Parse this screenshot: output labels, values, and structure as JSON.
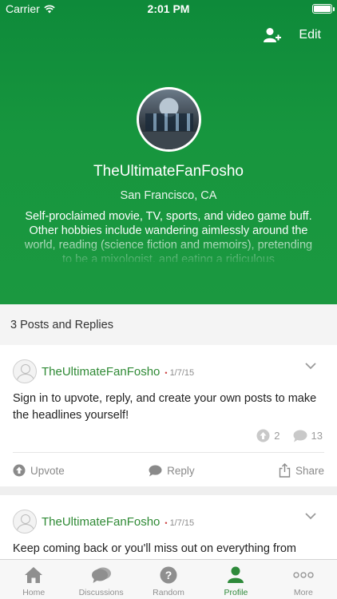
{
  "status_bar": {
    "carrier": "Carrier",
    "time": "2:01 PM"
  },
  "header": {
    "edit_label": "Edit",
    "username": "TheUltimateFanFosho",
    "location": "San Francisco, CA",
    "bio": "Self-proclaimed movie, TV, sports, and video game buff. Other hobbies include wandering aimlessly around the world, reading (science fiction and memoirs), pretending to be a mixologist, and eating a ridiculous"
  },
  "section_title": "3 Posts and Replies",
  "posts": [
    {
      "author": "TheUltimateFanFosho",
      "date": "1/7/15",
      "body": "Sign in to upvote, reply, and create your own posts to make the headlines yourself!",
      "upvotes": "2",
      "comments": "13",
      "actions": {
        "upvote": "Upvote",
        "reply": "Reply",
        "share": "Share"
      }
    },
    {
      "author": "TheUltimateFanFosho",
      "date": "1/7/15",
      "body": "Keep coming back or you'll miss out on everything from"
    }
  ],
  "tabs": [
    {
      "label": "Home",
      "icon": "home-icon"
    },
    {
      "label": "Discussions",
      "icon": "discussions-icon"
    },
    {
      "label": "Random",
      "icon": "random-icon"
    },
    {
      "label": "Profile",
      "icon": "profile-icon",
      "active": true
    },
    {
      "label": "More",
      "icon": "more-icon"
    }
  ],
  "colors": {
    "brand_green": "#1b9840",
    "link_green": "#2f8a35",
    "tab_active": "#2e8a3a"
  }
}
